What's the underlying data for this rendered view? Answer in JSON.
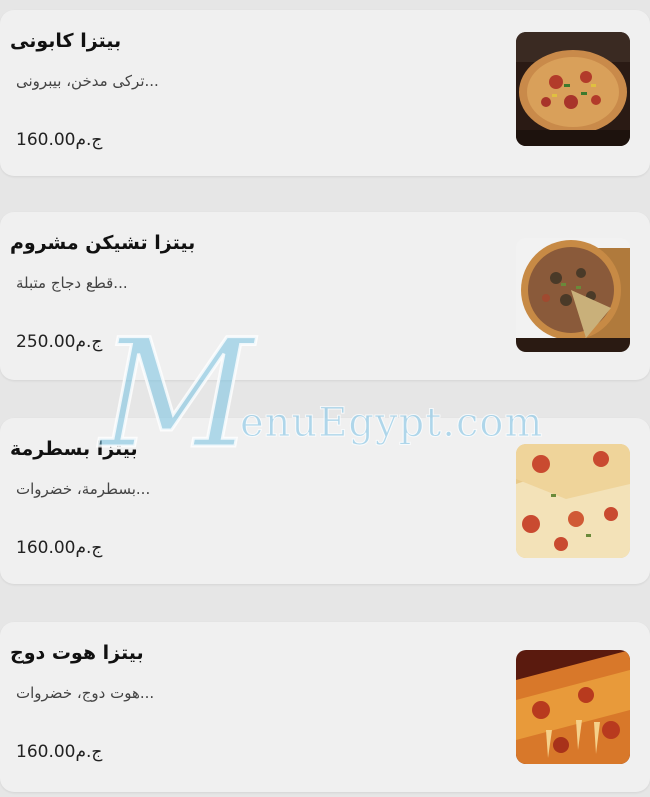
{
  "menu": {
    "items": [
      {
        "name": "بيتزا كابونى",
        "description": "...تركى مدخن، بيبرونى",
        "price": "ج.م160.00"
      },
      {
        "name": "بيتزا تشيكن مشروم",
        "description": "...قطع دجاج متبلة",
        "price": "ج.م250.00"
      },
      {
        "name": "بيتزا بسطرمة",
        "description": "...بسطرمة، خضروات",
        "price": "ج.م160.00"
      },
      {
        "name": "بيتزا هوت دوج",
        "description": "...هوت دوج، خضروات",
        "price": "ج.م160.00"
      }
    ]
  },
  "watermark": {
    "letter": "M",
    "text": "enuEgypt.com"
  }
}
